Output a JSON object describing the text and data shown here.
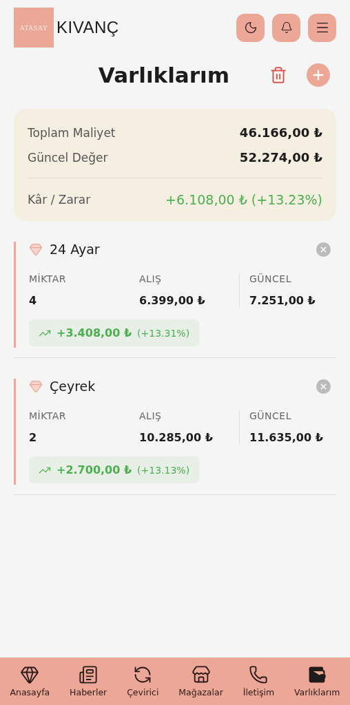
{
  "header": {
    "logo": "ATASAY",
    "brand": "KIVANÇ"
  },
  "title": "Varlıklarım",
  "summary": {
    "rows": [
      {
        "label": "Toplam Maliyet",
        "value": "46.166,00 ₺"
      },
      {
        "label": "Güncel Değer",
        "value": "52.274,00 ₺"
      }
    ],
    "profit": {
      "label": "Kâr / Zarar",
      "value": "+6.108,00 ₺ (+13.23%)"
    }
  },
  "assets": [
    {
      "name": "24 Ayar",
      "columns": [
        {
          "label": "MİKTAR",
          "value": "4"
        },
        {
          "label": "ALIŞ",
          "value": "6.399,00 ₺"
        },
        {
          "label": "GÜNCEL",
          "value": "7.251,00 ₺"
        }
      ],
      "gain": "+3.408,00 ₺",
      "percent": "(+13.31%)"
    },
    {
      "name": "Çeyrek",
      "columns": [
        {
          "label": "MİKTAR",
          "value": "2"
        },
        {
          "label": "ALIŞ",
          "value": "10.285,00 ₺"
        },
        {
          "label": "GÜNCEL",
          "value": "11.635,00 ₺"
        }
      ],
      "gain": "+2.700,00 ₺",
      "percent": "(+13.13%)"
    }
  ],
  "nav": [
    {
      "kind": "gem",
      "label": "Anasayfa",
      "selected": false
    },
    {
      "kind": "news",
      "label": "Haberler",
      "selected": false
    },
    {
      "kind": "convert",
      "label": "Çevirici",
      "selected": false
    },
    {
      "kind": "store",
      "label": "Mağazalar",
      "selected": false
    },
    {
      "kind": "phone",
      "label": "İletişim",
      "selected": false
    },
    {
      "kind": "wallet",
      "label": "Varlıklarım",
      "selected": true
    }
  ]
}
